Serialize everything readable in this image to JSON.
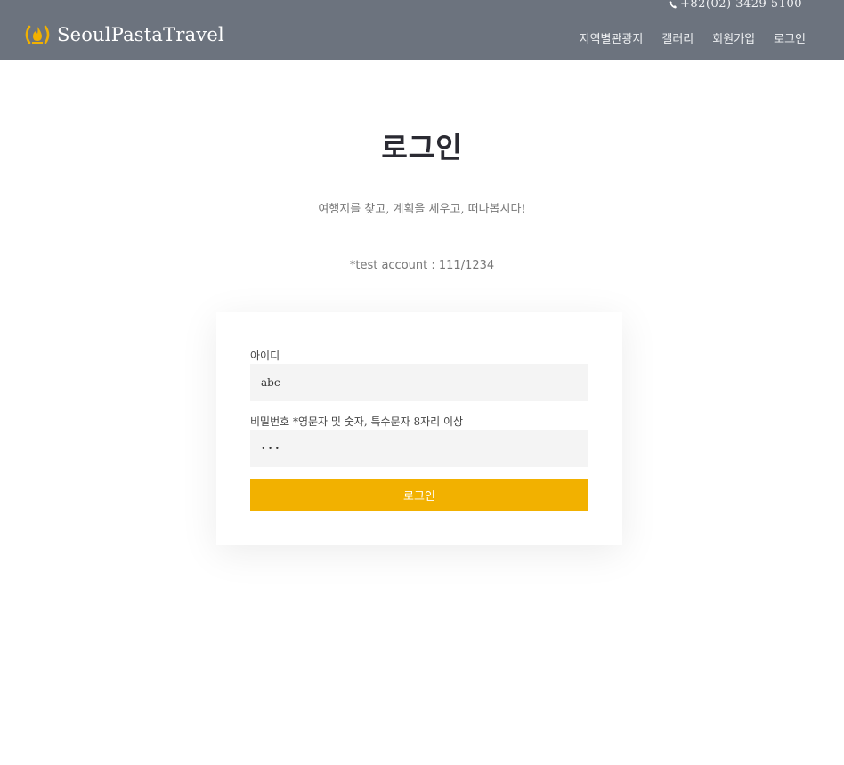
{
  "header": {
    "phone": "+82(02) 3429 5100",
    "brand": "SeoulPastaTravel",
    "nav": [
      "지역별관광지",
      "갤러리",
      "회원가입",
      "로그인"
    ]
  },
  "main": {
    "title": "로그인",
    "subtitle": "여행지를 찾고, 계획을 세우고, 떠나봅시다!",
    "test_account": "*test account : 111/1234"
  },
  "form": {
    "id_label": "아이디",
    "id_value": "abc",
    "pw_label": "비밀번호 *영문자 및 숫자, 특수문자 8자리 이상",
    "pw_value": "···",
    "submit_label": "로그인"
  },
  "colors": {
    "header_bg": "#6c737e",
    "accent": "#f2b100"
  }
}
